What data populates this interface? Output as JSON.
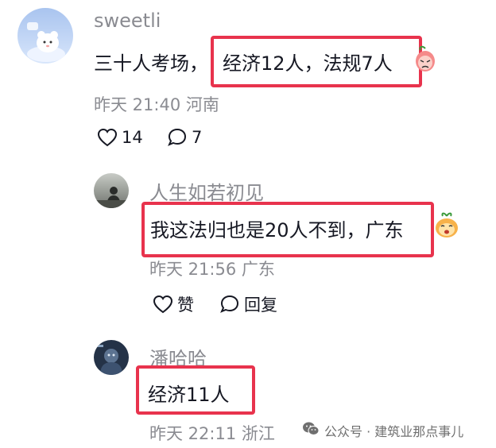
{
  "comments": [
    {
      "username": "sweetli",
      "text_prefix": "三十人考场，",
      "text_highlight": "经济12人，法规7人",
      "emoji": "sad-face-emoji",
      "time": "昨天 21:40",
      "location": "河南",
      "likes": "14",
      "replies": "7"
    },
    {
      "username": "人生如若初见",
      "text_highlight": "我这法归也是20人不到，广东",
      "emoji": "smiling-face-emoji",
      "time": "昨天 21:56",
      "location": "广东",
      "like_label": "赞",
      "reply_label": "回复"
    },
    {
      "username": "潘哈哈",
      "text_highlight": "经济11人",
      "time": "昨天 22:11",
      "location": "浙江"
    }
  ],
  "watermark": {
    "text": "公众号 · 建筑业那点事儿",
    "icon": "wechat-icon"
  },
  "colors": {
    "highlight": "#e8334d",
    "meta": "#8a8b91",
    "text": "#161823"
  }
}
